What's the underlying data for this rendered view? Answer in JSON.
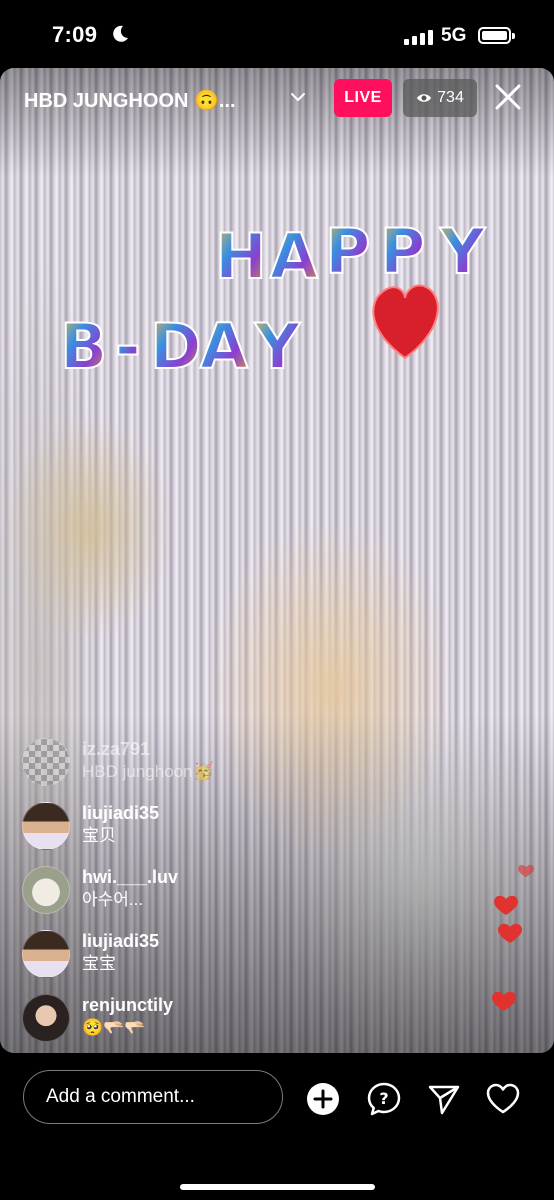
{
  "status_bar": {
    "time": "7:09",
    "network": "5G"
  },
  "header": {
    "title": "HBD JUNGHOON 🙃...",
    "live_label": "LIVE",
    "viewer_count": "734"
  },
  "video": {
    "balloon_letters": [
      "H",
      "A",
      "P",
      "P",
      "Y",
      "B",
      "-",
      "D",
      "A",
      "Y"
    ]
  },
  "comments": [
    {
      "username": "iz.za791",
      "message": "HBD junghoon🥳",
      "faded": true
    },
    {
      "username": "liujiadi35",
      "message": "宝贝"
    },
    {
      "username": "hwi.___.luv",
      "message": "아수어..."
    },
    {
      "username": "liujiadi35",
      "message": "宝宝"
    },
    {
      "username": "renjunctily",
      "message": "🥺🫳🏻🫳🏻"
    }
  ],
  "bottom_bar": {
    "comment_placeholder": "Add a comment..."
  },
  "colors": {
    "live_badge": "#ff0f5c",
    "heart": "#e0322e"
  },
  "icons": [
    "moon-icon",
    "signal-icon",
    "battery-icon",
    "chevron-down-icon",
    "eye-icon",
    "close-icon",
    "add-icon",
    "question-icon",
    "send-icon",
    "heart-icon"
  ]
}
